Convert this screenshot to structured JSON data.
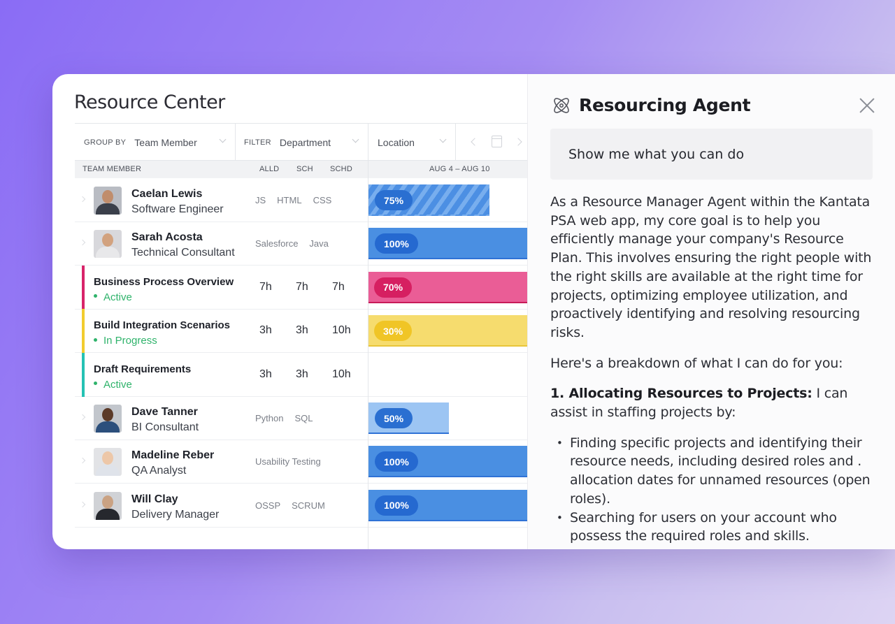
{
  "resource_center": {
    "title": "Resource Center",
    "toolbar": {
      "group_by_label": "GROUP BY",
      "group_by_value": "Team Member",
      "filter_label": "FILTER",
      "filter_value": "Department",
      "location_value": "Location"
    },
    "columns": {
      "team_member": "TEAM MEMBER",
      "alld": "ALLD",
      "sch": "SCH",
      "schd": "SCHD",
      "date_range": "AUG 4 – AUG 10"
    },
    "rows": [
      {
        "type": "person",
        "name": "Caelan Lewis",
        "role": "Software Engineer",
        "tags": [
          "JS",
          "HTML",
          "CSS"
        ],
        "allocation": "75%",
        "allocation_fraction": 0.75,
        "bar_color": "#4c8fe3",
        "pill_color": "#2a6fd1",
        "striped": true
      },
      {
        "type": "person",
        "name": "Sarah Acosta",
        "role": "Technical Consultant",
        "tags": [
          "Salesforce",
          "Java"
        ],
        "allocation": "100%",
        "allocation_fraction": 1.0,
        "bar_color": "#4a8fe2",
        "pill_color": "#2569d0"
      },
      {
        "type": "task",
        "name": "Business Process Overview",
        "status": "Active",
        "accent": "#d8246a",
        "alld": "7h",
        "sch": "7h",
        "schd": "7h",
        "allocation": "70%",
        "allocation_fraction": 1.0,
        "bar_color": "#ea5d96",
        "pill_color": "#d61f61"
      },
      {
        "type": "task",
        "name": "Build Integration Scenarios",
        "status": "In Progress",
        "accent": "#f2cc2e",
        "alld": "3h",
        "sch": "3h",
        "schd": "10h",
        "allocation": "30%",
        "allocation_fraction": 1.0,
        "bar_color": "#f6dc6e",
        "pill_color": "#f0c526"
      },
      {
        "type": "task",
        "name": "Draft Requirements",
        "status": "Active",
        "accent": "#25c2b4",
        "alld": "3h",
        "sch": "3h",
        "schd": "10h"
      },
      {
        "type": "person",
        "name": "Dave Tanner",
        "role": "BI Consultant",
        "tags": [
          "Python",
          "SQL"
        ],
        "allocation": "50%",
        "allocation_fraction": 0.5,
        "bar_color": "#9cc5f3",
        "pill_color": "#2a6fd1"
      },
      {
        "type": "person",
        "name": "Madeline Reber",
        "role": "QA Analyst",
        "tags": [
          "Usability Testing"
        ],
        "allocation": "100%",
        "allocation_fraction": 1.0,
        "bar_color": "#4a8fe2",
        "pill_color": "#2569d0"
      },
      {
        "type": "person",
        "name": "Will Clay",
        "role": "Delivery Manager",
        "tags": [
          "OSSP",
          "SCRUM"
        ],
        "allocation": "100%",
        "allocation_fraction": 1.0,
        "bar_color": "#4a8fe2",
        "pill_color": "#2569d0"
      }
    ]
  },
  "agent_panel": {
    "title": "Resourcing Agent",
    "icon": "atom-icon",
    "prompt": "Show me what you can do",
    "intro": "As a Resource Manager Agent within the Kantata PSA web app, my core goal is to help you efficiently manage your company's Resource Plan. This involves ensuring the right people with the right skills are available at the right time for projects, optimizing employee utilization, and proactively identifying and resolving resourcing risks.",
    "breakdown": "Here's a breakdown of what I can do for you:",
    "section_heading": "1. Allocating Resources to Projects:",
    "section_text": " I can assist in staffing projects by:",
    "bullets": [
      "Finding specific projects and identifying their resource needs, including desired roles and  . allocation dates for unnamed resources (open roles).",
      "Searching for users on your account who possess the required roles and skills."
    ]
  }
}
